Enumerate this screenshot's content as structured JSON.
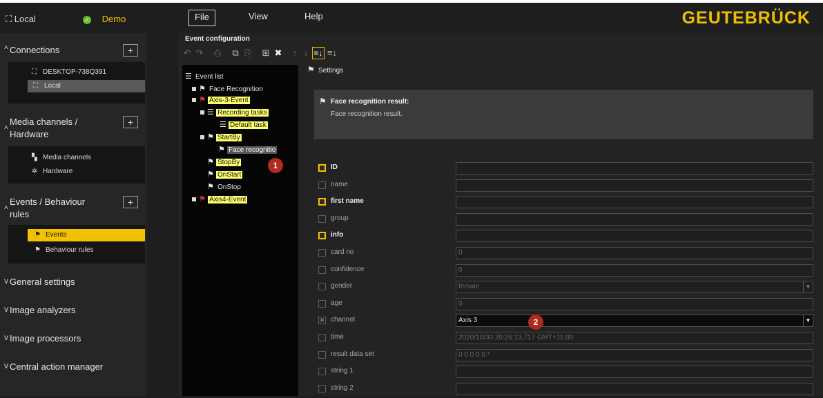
{
  "topbar": {
    "server_label": "Local",
    "profile_label": "Demo",
    "menu": [
      "File",
      "View",
      "Help"
    ],
    "logo": "GEUTEBRÜCK"
  },
  "sidebar": {
    "connections": {
      "title": "Connections",
      "items": [
        {
          "label": "DESKTOP-738Q391",
          "icon": "network-icon"
        },
        {
          "label": "Local",
          "icon": "network-icon",
          "selected": true
        }
      ]
    },
    "media": {
      "title_line1": "Media channels /",
      "title_line2": "Hardware",
      "items": [
        {
          "label": "Media channels",
          "icon": "camera-icon"
        },
        {
          "label": "Hardware",
          "icon": "gear-icon"
        }
      ]
    },
    "events": {
      "title_line1": "Events / Behaviour",
      "title_line2": "rules",
      "items": [
        {
          "label": "Events",
          "icon": "flag-icon",
          "selected": true
        },
        {
          "label": "Behaviour rules",
          "icon": "flag-icon"
        }
      ]
    },
    "collapsed": [
      "General settings",
      "Image analyzers",
      "Image processors",
      "Central action manager"
    ]
  },
  "event_config": {
    "title": "Event configuration",
    "tree": {
      "root": "Event list",
      "nodes": [
        "Face Recognition",
        "Axis-3-Event",
        "Recording tasks",
        "Default task",
        "StartBy",
        "Face recognitio",
        "StopBy",
        "OnStart",
        "OnStop",
        "Axis4-Event"
      ]
    },
    "markers": [
      "1",
      "2"
    ]
  },
  "settings": {
    "title": "Settings",
    "result_title": "Face recognition result:",
    "result_desc": "Face recognition result.",
    "fields": [
      {
        "label": "ID",
        "checked": true,
        "value": ""
      },
      {
        "label": "name",
        "checked": false,
        "value": ""
      },
      {
        "label": "first name",
        "checked": true,
        "value": ""
      },
      {
        "label": "group",
        "checked": false,
        "value": ""
      },
      {
        "label": "info",
        "checked": true,
        "value": ""
      },
      {
        "label": "card no",
        "checked": false,
        "value": "0"
      },
      {
        "label": "confidence",
        "checked": false,
        "value": "0"
      },
      {
        "label": "gender",
        "checked": false,
        "value": "female"
      },
      {
        "label": "age",
        "checked": false,
        "value": "0"
      },
      {
        "label": "channel",
        "checked": false,
        "value": "Axis 3"
      },
      {
        "label": "time",
        "checked": false,
        "value": "2020/10/30 20:26:13,717 GMT+11:00"
      },
      {
        "label": "result data set",
        "checked": false,
        "value": "0 0 0 0 0 *"
      },
      {
        "label": "string 1",
        "checked": false,
        "value": ""
      },
      {
        "label": "string 2",
        "checked": false,
        "value": ""
      }
    ]
  },
  "colors": {
    "accent": "#f2c200",
    "marker": "#b02a1e",
    "tree_highlight": "#ffff70"
  }
}
